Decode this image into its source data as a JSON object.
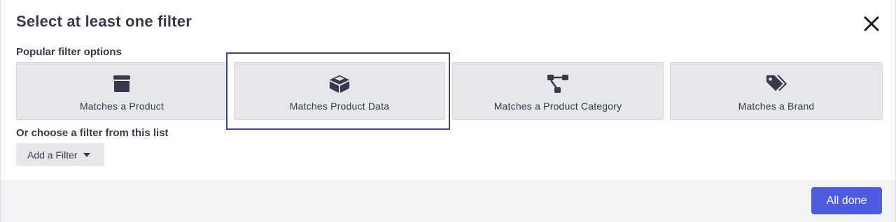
{
  "dialog": {
    "title": "Select at least one filter",
    "close_icon": "close-icon"
  },
  "popular": {
    "label": "Popular filter options",
    "options": [
      {
        "label": "Matches a Product",
        "icon": "box-icon",
        "selected": false
      },
      {
        "label": "Matches Product Data",
        "icon": "open-box-icon",
        "selected": true
      },
      {
        "label": "Matches a Product Category",
        "icon": "category-tree-icon",
        "selected": false
      },
      {
        "label": "Matches a Brand",
        "icon": "tags-icon",
        "selected": false
      }
    ]
  },
  "choose": {
    "label": "Or choose a filter from this list",
    "add_filter_label": "Add a Filter"
  },
  "footer": {
    "done_label": "All done"
  },
  "colors": {
    "primary": "#4d5ce0",
    "selected_outline": "#3c3fb0",
    "card_bg": "#e6e7eb",
    "text": "#363a4b",
    "footer_bg": "#f2f3f5"
  }
}
